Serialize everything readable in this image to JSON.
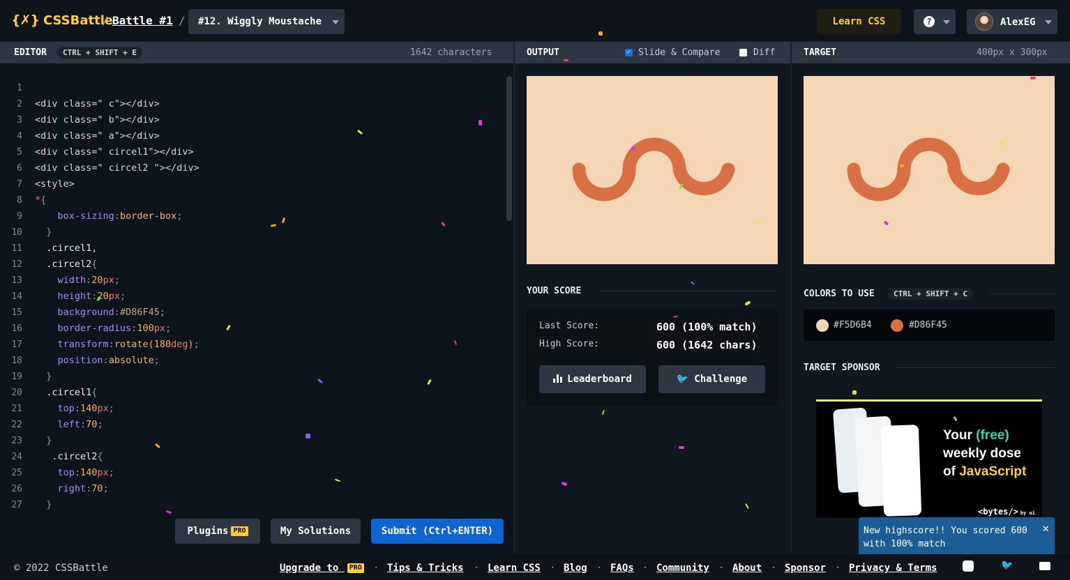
{
  "topbar": {
    "logo_mark": "{✗}",
    "logo_text": "CSSBattle",
    "separator": "/",
    "battle_link": "Battle #1",
    "target_select": "#12. Wiggly Moustache",
    "learn_css": "Learn CSS",
    "help_icon": "?",
    "user_name": "AlexEG"
  },
  "editor": {
    "title": "EDITOR",
    "shortcut": "CTRL + SHIFT + E",
    "char_count": "1642 characters",
    "line_numbers": [
      "1",
      "2",
      "3",
      "4",
      "5",
      "6",
      "7",
      "8",
      "9",
      "10",
      "11",
      "12",
      "13",
      "14",
      "15",
      "16",
      "17",
      "18",
      "19",
      "20",
      "21",
      "22",
      "23",
      "24",
      "25",
      "26",
      "27"
    ],
    "code_lines": [
      "",
      "<div class=\" c\"></div>",
      "<div class=\" b\"></div>",
      "<div class=\" a\"></div>",
      "<div class=\" circel1\"></div>",
      "<div class=\" circel2 \"></div>",
      "<style>",
      "*{",
      "    box-sizing:border-box;",
      "  }",
      "  .circel1,",
      "  .circel2{",
      "    width:20px;",
      "    height:20px;",
      "    background:#D86F45;",
      "    border-radius:100px;",
      "    transform:rotate(180deg);",
      "    position:absolute;",
      "  }",
      "  .circel1{",
      "    top:140px;",
      "    left:70;",
      "  }",
      "   .circel2{",
      "    top:140px;",
      "    right:70;",
      "  }"
    ],
    "plugins_label": "Plugins",
    "pro_badge": "PRO",
    "my_solutions_label": "My Solutions",
    "submit_label": "Submit (Ctrl+ENTER)"
  },
  "output": {
    "title": "OUTPUT",
    "slide_compare_label": "Slide & Compare",
    "slide_compare_checked": true,
    "diff_label": "Diff",
    "diff_checked": false
  },
  "target": {
    "title": "TARGET",
    "dimensions": "400px x 300px"
  },
  "score": {
    "title": "YOUR SCORE",
    "last_label": "Last Score:",
    "last_value": "600 (100% match)",
    "high_label": "High Score:",
    "high_value": "600 (1642 chars)",
    "leaderboard_label": "Leaderboard",
    "challenge_label": "Challenge"
  },
  "colors": {
    "title": "COLORS TO USE",
    "shortcut": "CTRL + SHIFT + C",
    "items": [
      {
        "hex": "#F5D6B4",
        "label": "#F5D6B4"
      },
      {
        "hex": "#D86F45",
        "label": "#D86F45"
      }
    ]
  },
  "sponsor": {
    "title": "TARGET SPONSOR",
    "headline_1": "Your",
    "headline_free": "(free)",
    "headline_2": "weekly dose",
    "headline_3": "of",
    "headline_js": "JavaScript",
    "brand": "<bytes/>",
    "brand_by": "by ui"
  },
  "toast": {
    "message": "New highscore!! You scored 600 with 100% match",
    "progress": 0.6
  },
  "footer": {
    "copyright": "© 2022 CSSBattle",
    "links": [
      "Upgrade to",
      "Tips & Tricks",
      "Learn CSS",
      "Blog",
      "FAQs",
      "Community",
      "About",
      "Sponsor",
      "Privacy & Terms"
    ],
    "pro_badge": "PRO"
  },
  "theme": {
    "accent_yellow": "#ffcf35",
    "submit_blue": "#0f64d2",
    "canvas_bg": "#F5D6B4",
    "shape_color": "#D86F45"
  }
}
